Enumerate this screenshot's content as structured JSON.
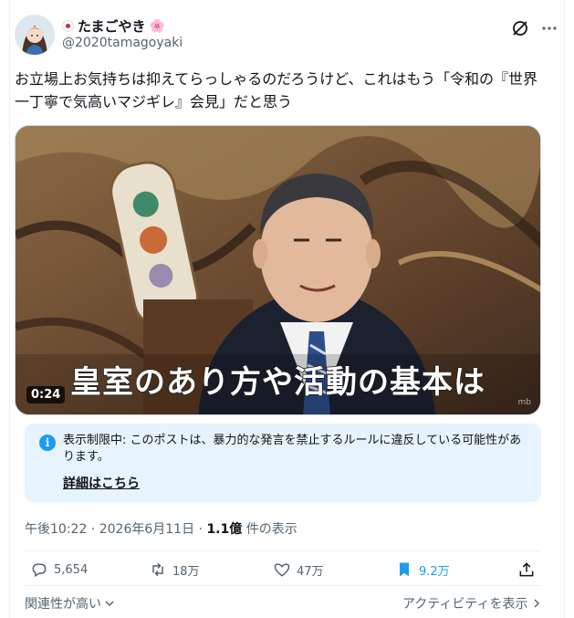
{
  "author": {
    "display_name": "たまごやき",
    "handle": "@2020tamagoyaki",
    "flag_icon": "japan-flag-icon",
    "sakura_glyph": "🌸"
  },
  "tweet": {
    "text": "お立場上お気持ちは抑えてらっしゃるのだろうけど、これはもう「令和の『世界一丁寧で気高いマジギレ』会見」だと思う"
  },
  "media": {
    "duration": "0:24",
    "subtitle": "皇室のあり方や活動の基本は",
    "watermark": "mb"
  },
  "notice": {
    "text": "表示制限中: このポストは、暴力的な発言を禁止するルールに違反している可能性があります。",
    "link_label": "詳細はこちら"
  },
  "meta": {
    "time": "午後10:22",
    "date": "2026年6月11日",
    "sep": "·",
    "views_count": "1.1億",
    "views_label": "件の表示"
  },
  "actions": {
    "replies": "5,654",
    "reposts": "18万",
    "likes": "47万",
    "bookmarks": "9.2万"
  },
  "footer": {
    "relevance_label": "関連性が高い",
    "activity_label": "アクティビティを表示"
  },
  "colors": {
    "accent": "#1d9bf0",
    "notice_bg": "#e8f4fd",
    "muted": "#536471"
  }
}
